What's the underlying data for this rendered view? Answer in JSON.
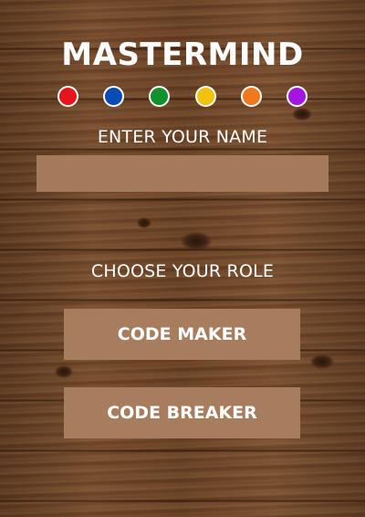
{
  "game": {
    "title": "MASTERMIND"
  },
  "pegs": [
    {
      "name": "red",
      "color": "#e8141c"
    },
    {
      "name": "blue",
      "color": "#0a4bb5"
    },
    {
      "name": "green",
      "color": "#11912e"
    },
    {
      "name": "yellow",
      "color": "#f0c20a"
    },
    {
      "name": "orange",
      "color": "#f2781c"
    },
    {
      "name": "purple",
      "color": "#a515e0"
    }
  ],
  "name_section": {
    "label": "ENTER YOUR NAME",
    "input_value": "",
    "input_placeholder": ""
  },
  "role_section": {
    "label": "CHOOSE YOUR ROLE",
    "code_maker_label": "CODE MAKER",
    "code_breaker_label": "CODE BREAKER"
  },
  "theme": {
    "button_color": "#a77d5d",
    "input_color": "#a47a5a",
    "text_color": "#ffffff"
  }
}
